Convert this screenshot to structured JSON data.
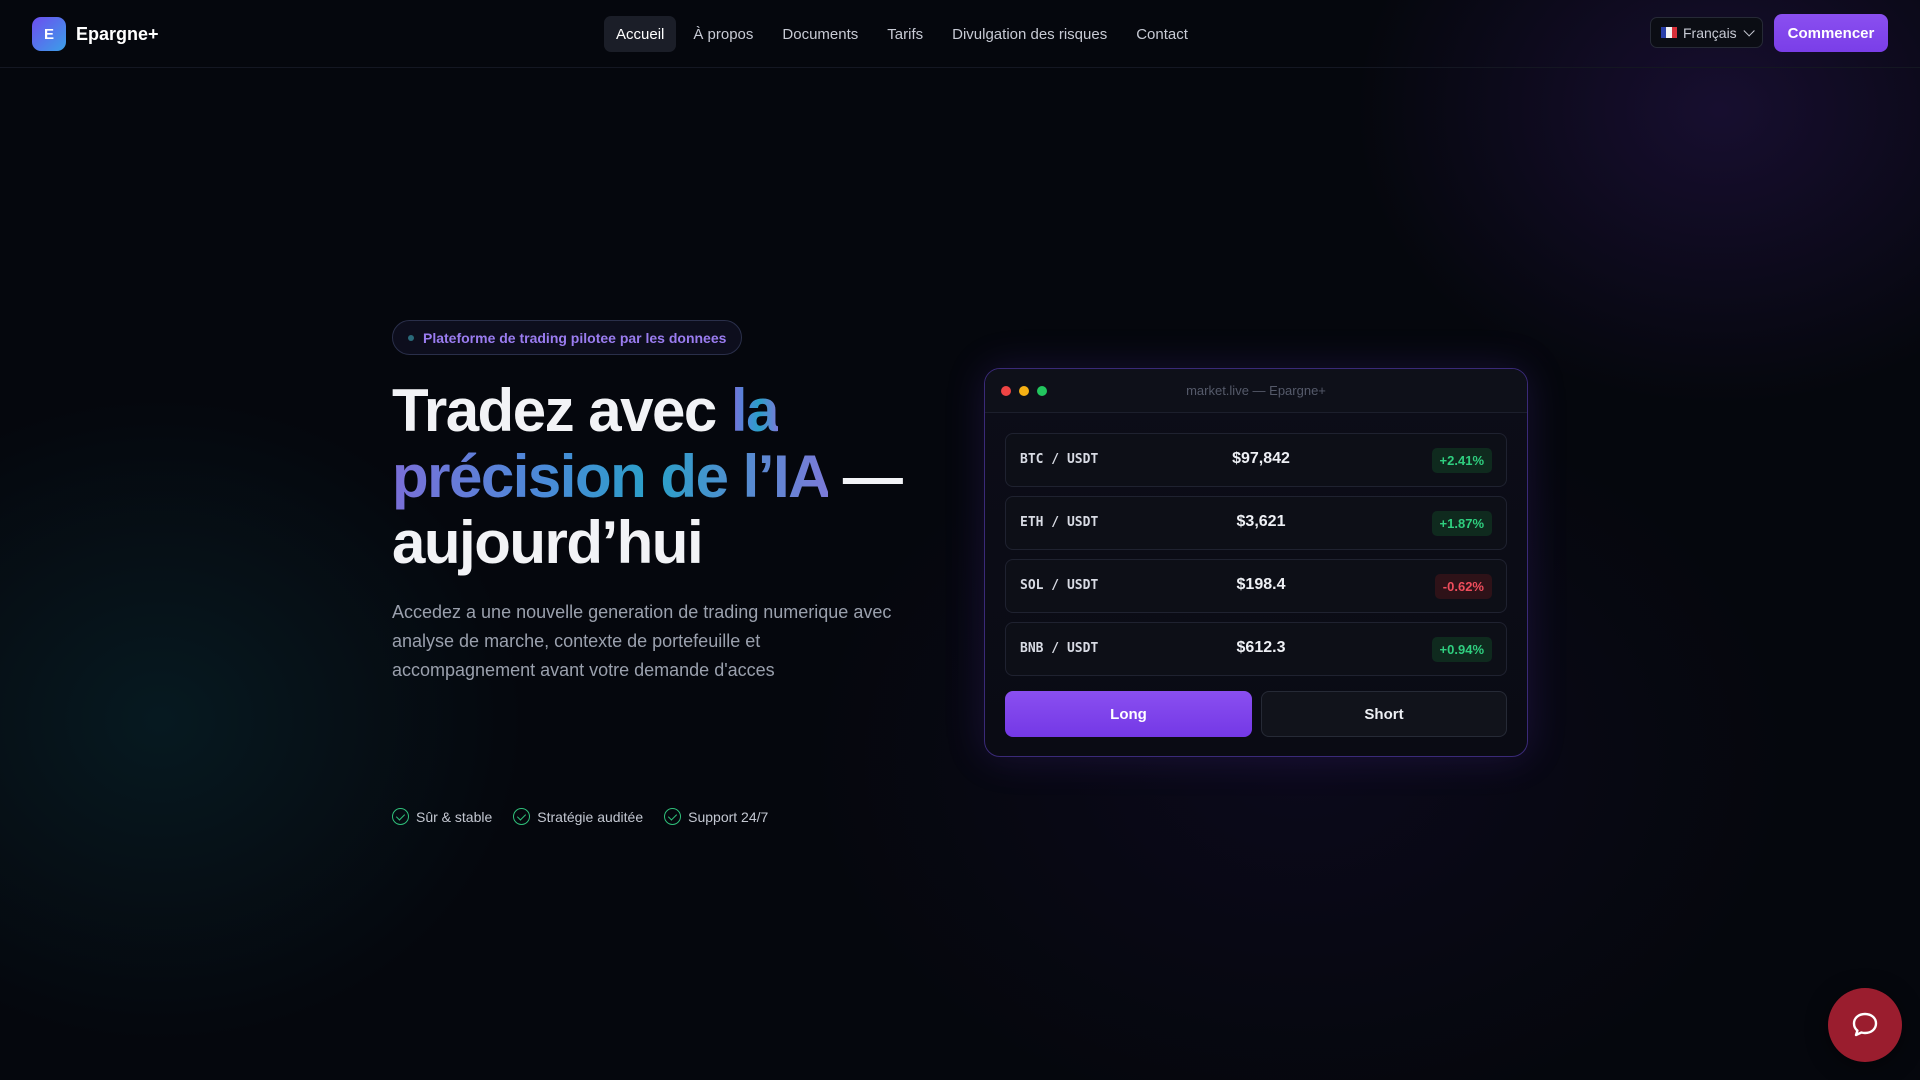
{
  "brand": {
    "mark": "E",
    "name": "Epargne+"
  },
  "nav": {
    "items": [
      {
        "label": "Accueil",
        "active": true
      },
      {
        "label": "À propos"
      },
      {
        "label": "Documents"
      },
      {
        "label": "Tarifs"
      },
      {
        "label": "Divulgation des risques"
      },
      {
        "label": "Contact"
      }
    ],
    "language": "Français",
    "cta": "Commencer"
  },
  "hero": {
    "badge": "Plateforme de trading pilotee par les donnees",
    "headline": {
      "line1_plain": "Tradez avec ",
      "line1_accent": "la",
      "line2_accent": "précision de l’IA",
      "line2_plain": " —",
      "line3": "aujourd’hui"
    },
    "subtitle": "Accedez a une nouvelle generation de trading numerique avec analyse de marche, contexte de portefeuille et accompagnement avant votre demande d'acces",
    "trust": [
      "Sûr & stable",
      "Stratégie auditée",
      "Support 24/7"
    ]
  },
  "market": {
    "window_title": "market.live — Epargne+",
    "rows": [
      {
        "pair": "BTC / USDT",
        "price": "$97,842",
        "change": "+2.41%",
        "direction": "up"
      },
      {
        "pair": "ETH / USDT",
        "price": "$3,621",
        "change": "+1.87%",
        "direction": "up"
      },
      {
        "pair": "SOL / USDT",
        "price": "$198.4",
        "change": "-0.62%",
        "direction": "down"
      },
      {
        "pair": "BNB / USDT",
        "price": "$612.3",
        "change": "+0.94%",
        "direction": "up"
      }
    ],
    "long_label": "Long",
    "short_label": "Short"
  },
  "colors": {
    "accent": "#7c42ea",
    "up": "#2fcf7f",
    "down": "#ef4d5c",
    "chat": "#9a1d2e"
  },
  "icons": {
    "chat": "chat-bubble-icon",
    "check": "check-circle-icon",
    "flag": "france-flag-icon",
    "dropdown": "chevron-down-icon"
  }
}
